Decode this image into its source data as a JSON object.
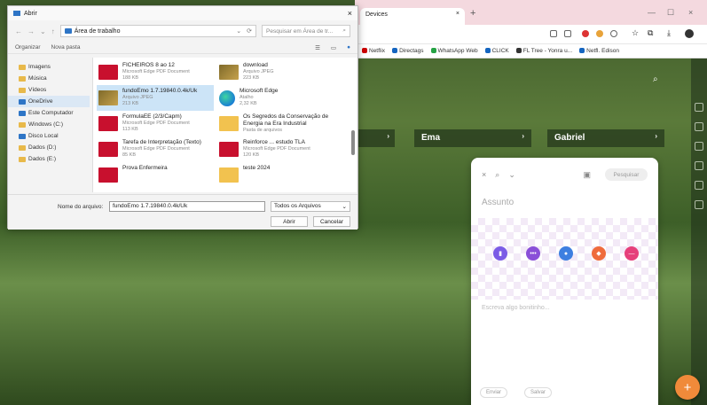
{
  "browser": {
    "tab_label": "Devices",
    "bookmarks": [
      {
        "label": "Netflix",
        "color": "#c00"
      },
      {
        "label": "Directags",
        "color": "#1565c0"
      },
      {
        "label": "WhatsApp Web",
        "color": "#25a244"
      },
      {
        "label": "CLICK",
        "color": "#1565c0"
      },
      {
        "label": "FL Tree - Yonra u...",
        "color": "#333"
      },
      {
        "label": "Netfl. Edison",
        "color": "#1565c0"
      }
    ]
  },
  "page": {
    "section_heads": [
      "Ema",
      "Gabriel"
    ]
  },
  "dialog": {
    "title": "Abrir",
    "address": "Área de trabalho",
    "search_placeholder": "Pesquisar em Área de tr...",
    "commands": [
      "Organizar",
      "Nova pasta"
    ],
    "nav_items": [
      {
        "label": "Imagens",
        "kind": "folder"
      },
      {
        "label": "Música",
        "kind": "folder"
      },
      {
        "label": "Vídeos",
        "kind": "folder"
      },
      {
        "label": "OneDrive",
        "kind": "pc"
      },
      {
        "label": "Este Computador",
        "kind": "pc"
      },
      {
        "label": "Windows (C:)",
        "kind": "folder"
      },
      {
        "label": "Disco Local",
        "kind": "pc"
      },
      {
        "label": "Dados (D:)",
        "kind": "folder"
      },
      {
        "label": "Dados (E:)",
        "kind": "folder"
      }
    ],
    "files": [
      {
        "name": "FICHEIROS 8 ao 12",
        "meta": "Microsoft Edge PDF Document",
        "size": "188 KB",
        "kind": "pdf",
        "selected": false
      },
      {
        "name": "download",
        "meta": "Arquivo JPEG",
        "size": "223 KB",
        "kind": "photo",
        "selected": false
      },
      {
        "name": "fundoEmo 1.7.19840.0.4k/Uk",
        "meta": "Arquivo JPEG",
        "size": "213 KB",
        "kind": "photo",
        "selected": true
      },
      {
        "name": "Microsoft Edge",
        "meta": "Atalho",
        "size": "2,32 KB",
        "kind": "edge",
        "selected": false
      },
      {
        "name": "FormulaEE (2/3/Capm)",
        "meta": "Microsoft Edge PDF Document",
        "size": "113 KB",
        "kind": "pdf",
        "selected": false
      },
      {
        "name": "Os Segredos da Conservação de Energia na Era Industrial",
        "meta": "Pasta de arquivos",
        "size": "",
        "kind": "folder",
        "selected": false
      },
      {
        "name": "Tarefa de Interpretação (Texto)",
        "meta": "Microsoft Edge PDF Document",
        "size": "85 KB",
        "kind": "pdf",
        "selected": false
      },
      {
        "name": "Reinforce ... estudo TLA",
        "meta": "Microsoft Edge PDF Document",
        "size": "120 KB",
        "kind": "pdf",
        "selected": false
      },
      {
        "name": "Prova Enfermeira",
        "meta": "",
        "size": "",
        "kind": "pdf",
        "selected": false
      },
      {
        "name": "teste 2024",
        "meta": "",
        "size": "",
        "kind": "folder",
        "selected": false
      }
    ],
    "filename_label": "Nome do arquivo:",
    "filename_value": "fundoEmo 1.7.19840.0.4k/Uk",
    "type_value": "Todos os Arquivos",
    "open_label": "Abrir",
    "cancel_label": "Cancelar"
  },
  "note": {
    "top_button": "Pesquisar",
    "subject_placeholder": "Assunto",
    "body_placeholder": "Escreva algo bonitinho...",
    "colors": [
      "#7b5ce6",
      "#8a4fd8",
      "#3d7fe0",
      "#ef6b3c",
      "#e6407a"
    ],
    "chips": [
      "Enviar",
      "Salvar"
    ]
  },
  "fab_icon": "plus-icon"
}
